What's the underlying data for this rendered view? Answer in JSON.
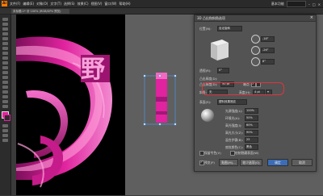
{
  "app": {
    "logo": "Ai",
    "menus": [
      "文件(F)",
      "编辑(E)",
      "对象(O)",
      "文字(T)",
      "选择(S)",
      "效果(C)",
      "视图(V)",
      "窗口(W)",
      "帮助(H)"
    ],
    "workspace": "基本功能",
    "tab_title": "未标题-1* @ 100% (RGB/GPU 预览)"
  },
  "canvas": {
    "glyph": "野",
    "accent_color": "#e0239e"
  },
  "dialog": {
    "title": "3D 凸出和斜角选项",
    "position_label": "位置(N):",
    "position_value": "自定旋转",
    "angle_x": "-18°",
    "angle_y": "-26°",
    "angle_z": "8°",
    "perspective_label": "透视(R):",
    "perspective_value": "0°",
    "extrude_depth_label": "凸出厚度(D):",
    "extrude_depth_value": "50 pt",
    "cap_label": "端点:",
    "bevel_label": "斜角:",
    "bevel_value": "无",
    "height_label": "高度(H):",
    "height_value": "4 pt",
    "surface_label": "表面(S):",
    "surface_value": "塑料效果底纹",
    "light_intensity_label": "光源强度(L):",
    "light_intensity_value": "100%",
    "ambient_label": "环境光(A):",
    "ambient_value": "50%",
    "highlight_label": "高光强度(I):",
    "highlight_value": "60%",
    "highlight_size_label": "高光大小(Z):",
    "highlight_size_value": "90%",
    "blend_steps_label": "混合步骤(B):",
    "blend_steps_value": "25",
    "shade_color_label": "底纹颜色(C):",
    "shade_color_value": "黑色",
    "preserve_spot_label": "保留专色(V)",
    "draw_hidden_label": "绘制隐藏表面(W)",
    "preview_label": "预览(P)",
    "map_label": "贴图(M)...",
    "fewer_options_label": "较少选项(O)",
    "ok_label": "确定",
    "cancel_label": "取消"
  }
}
